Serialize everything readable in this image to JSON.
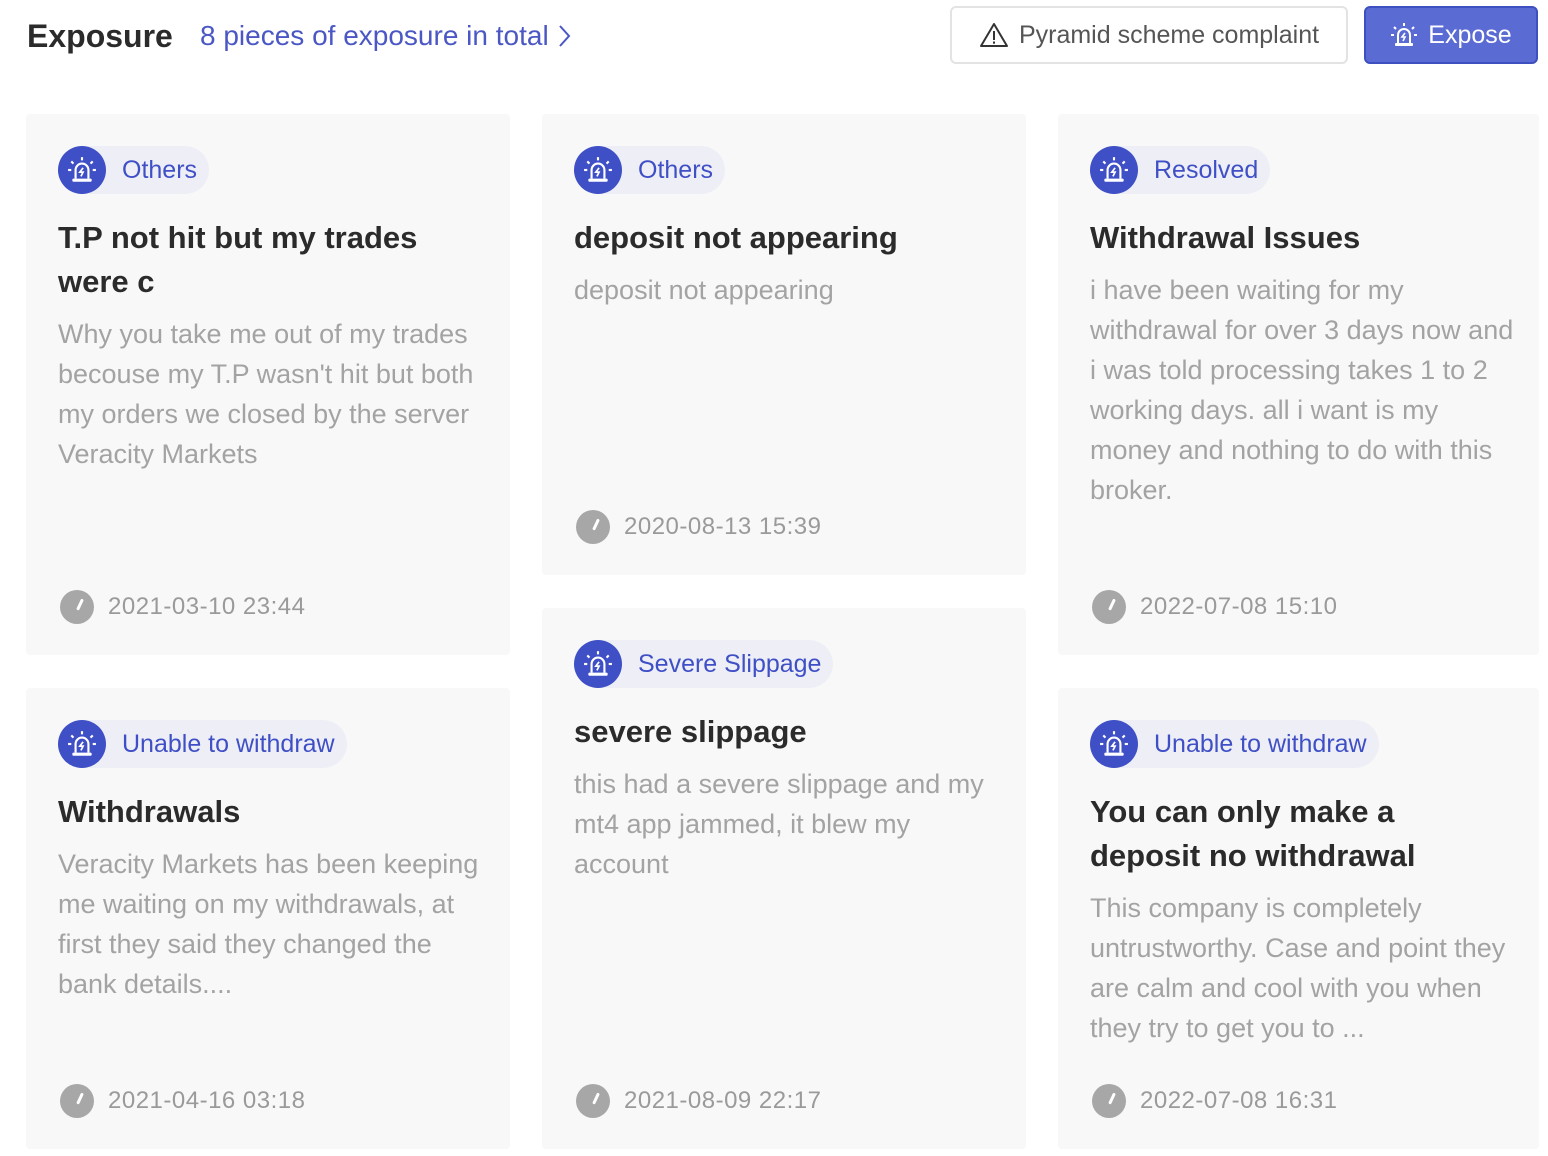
{
  "header": {
    "title": "Exposure",
    "total_link": "8 pieces of exposure in total",
    "complaint_button": "Pyramid scheme complaint",
    "expose_button": "Expose"
  },
  "cards": [
    {
      "tag": "Others",
      "title": "T.P not hit but my trades were c",
      "body": "Why you take me out of my trades becouse my T.P wasn't hit but both my orders we closed by the server Veracity Markets",
      "time": "2021-03-10 23:44"
    },
    {
      "tag": "Others",
      "title": "deposit not appearing",
      "body": "deposit not appearing",
      "time": "2020-08-13 15:39"
    },
    {
      "tag": "Resolved",
      "title": "Withdrawal Issues",
      "body": "i have been waiting for my withdrawal for over 3 days now and i was told processing takes 1 to 2 working days. all i want is my money and nothing to do with this broker.",
      "time": "2022-07-08 15:10"
    },
    {
      "tag": "Unable to withdraw",
      "title": "Withdrawals",
      "body": "Veracity Markets has been keeping me waiting on my withdrawals, at first they said they changed the bank details....",
      "time": "2021-04-16 03:18"
    },
    {
      "tag": "Severe Slippage",
      "title": "severe slippage",
      "body": "this had a severe slippage and my mt4 app jammed, it blew my account",
      "time": "2021-08-09 22:17"
    },
    {
      "tag": "Unable to withdraw",
      "title": "You can only make a deposit no withdrawal",
      "body": "This company is completely untrustworthy. Case and point they are calm and cool with you when they try to get you to ...",
      "time": "2022-07-08 16:31"
    }
  ],
  "colors": {
    "accent": "#3f4fc6",
    "expose_button_bg": "#5b6bd4",
    "card_bg": "#f8f8f8",
    "muted_text": "#a3a3a3"
  },
  "icons": {
    "tag": "alarm-siren-icon",
    "time": "clock-icon",
    "complaint": "warning-triangle-icon",
    "total_link": "chevron-right-icon"
  }
}
